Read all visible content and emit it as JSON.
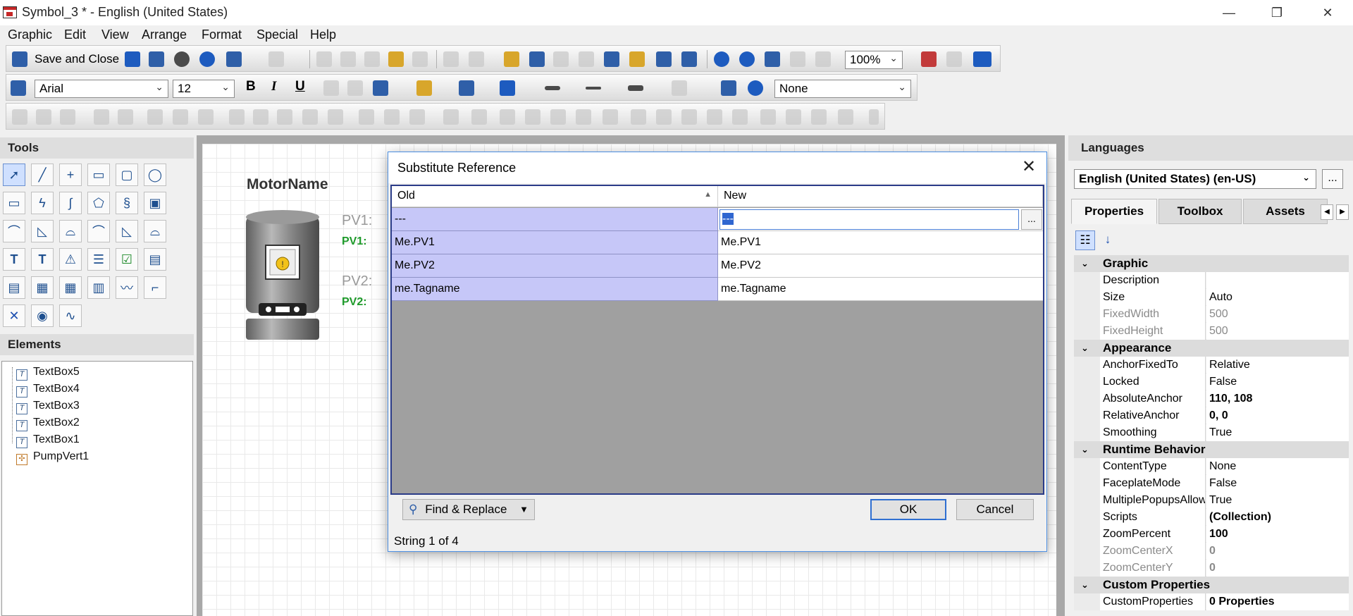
{
  "window": {
    "title": "Symbol_3 * - English (United States)",
    "controls": {
      "minimize": "—",
      "restore": "❐",
      "close": "✕"
    }
  },
  "menu": [
    "Graphic",
    "Edit",
    "View",
    "Arrange",
    "Format",
    "Special",
    "Help"
  ],
  "toolbar": {
    "save_close_label": "Save and Close",
    "zoom": "100%",
    "font_family": "Arial",
    "font_size": "12",
    "bold": "B",
    "italic": "I",
    "underline": "U",
    "fill_style": "None"
  },
  "tools_panel": {
    "header": "Tools"
  },
  "elements_panel": {
    "header": "Elements",
    "items": [
      "TextBox5",
      "TextBox4",
      "TextBox3",
      "TextBox2",
      "TextBox1",
      "PumpVert1"
    ]
  },
  "canvas": {
    "motor_name": "MotorName",
    "pv1_label": "PV1:",
    "pv1_value": "PV1:",
    "pv2_label": "PV2:",
    "pv2_value": "PV2:"
  },
  "languages": {
    "header": "Languages",
    "selected": "English (United States) (en-US)",
    "more": "..."
  },
  "right_tabs": [
    "Properties",
    "Toolbox",
    "Assets"
  ],
  "properties": [
    {
      "category": "Graphic",
      "rows": [
        {
          "name": "Description",
          "value": "",
          "dim": false,
          "bold": false
        },
        {
          "name": "Size",
          "value": "Auto",
          "dim": false,
          "bold": false
        },
        {
          "name": "FixedWidth",
          "value": "500",
          "dim": true,
          "bold": false
        },
        {
          "name": "FixedHeight",
          "value": "500",
          "dim": true,
          "bold": false
        }
      ]
    },
    {
      "category": "Appearance",
      "rows": [
        {
          "name": "AnchorFixedTo",
          "value": "Relative",
          "dim": false,
          "bold": false
        },
        {
          "name": "Locked",
          "value": "False",
          "dim": false,
          "bold": false
        },
        {
          "name": "AbsoluteAnchor",
          "value": "110, 108",
          "dim": false,
          "bold": true
        },
        {
          "name": "RelativeAnchor",
          "value": "0, 0",
          "dim": false,
          "bold": true
        },
        {
          "name": "Smoothing",
          "value": "True",
          "dim": false,
          "bold": false
        }
      ]
    },
    {
      "category": "Runtime Behavior",
      "rows": [
        {
          "name": "ContentType",
          "value": "None",
          "dim": false,
          "bold": false
        },
        {
          "name": "FaceplateMode",
          "value": "False",
          "dim": false,
          "bold": false
        },
        {
          "name": "MultiplePopupsAllow",
          "value": "True",
          "dim": false,
          "bold": false
        },
        {
          "name": "Scripts",
          "value": "(Collection)",
          "dim": false,
          "bold": true
        },
        {
          "name": "ZoomPercent",
          "value": "100",
          "dim": false,
          "bold": true
        },
        {
          "name": "ZoomCenterX",
          "value": "0",
          "dim": true,
          "bold": true
        },
        {
          "name": "ZoomCenterY",
          "value": "0",
          "dim": true,
          "bold": true
        }
      ]
    },
    {
      "category": "Custom Properties",
      "rows": [
        {
          "name": "CustomProperties",
          "value": "0 Properties",
          "dim": false,
          "bold": true
        }
      ]
    }
  ],
  "dialog": {
    "title": "Substitute Reference",
    "close": "✕",
    "columns": {
      "old": "Old",
      "new": "New"
    },
    "rows": [
      {
        "old": "---",
        "new": "---"
      },
      {
        "old": "Me.PV1",
        "new": "Me.PV1"
      },
      {
        "old": "Me.PV2",
        "new": "Me.PV2"
      },
      {
        "old": "me.Tagname",
        "new": "me.Tagname"
      }
    ],
    "edit_more": "...",
    "find_replace_label": "Find & Replace",
    "ok_label": "OK",
    "cancel_label": "Cancel",
    "status": "String 1 of 4"
  }
}
